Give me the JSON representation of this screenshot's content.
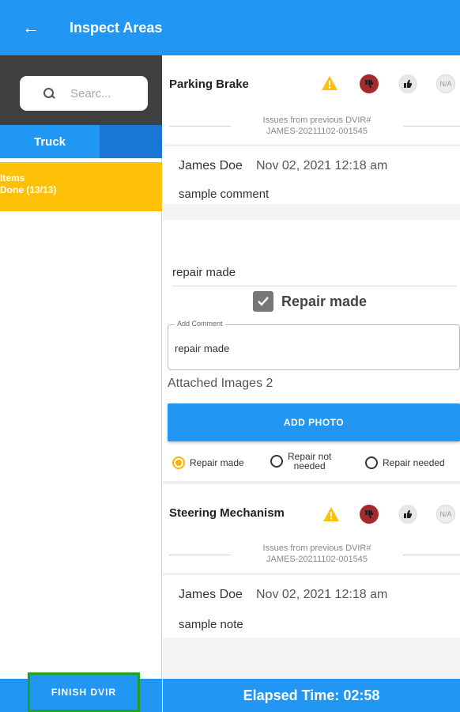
{
  "header": {
    "title": "Inspect Areas"
  },
  "sidebar": {
    "search_placeholder": "Searc...",
    "tab_truck": "Truck",
    "items_line1": "Items",
    "items_line2": "Done (13/13)",
    "finish_label": "FINISH DVIR"
  },
  "items": [
    {
      "title": "Parking Brake",
      "prev_issue_line1": "Issues from previous DVIR#",
      "prev_issue_line2": "JAMES-20211102-001545",
      "comment_name": "James Doe",
      "comment_date": "Nov 02, 2021 12:18 am",
      "comment_text": "sample comment"
    },
    {
      "title": "Steering Mechanism",
      "prev_issue_line1": "Issues from previous DVIR#",
      "prev_issue_line2": "JAMES-20211102-001545",
      "comment_name": "James Doe",
      "comment_date": "Nov 02, 2021 12:18 am",
      "comment_text": "sample note"
    }
  ],
  "status_buttons": {
    "na_label": "N/A"
  },
  "repair": {
    "repair_text": "repair made",
    "checkbox_label": "Repair made",
    "add_comment_legend": "Add Comment",
    "add_comment_value": "repair made",
    "attached_images": "Attached Images 2",
    "add_photo_label": "ADD PHOTO",
    "radio_repair_made": "Repair made",
    "radio_not_needed_line1": "Repair not",
    "radio_not_needed_line2": "needed",
    "radio_repair_needed": "Repair needed",
    "selected": "Repair made"
  },
  "footer": {
    "elapsed_label": "Elapsed Time:",
    "elapsed_value": "02:58"
  },
  "colors": {
    "primary": "#2196f3",
    "items_done": "#ffc107",
    "thumbs_down": "#a52a2a",
    "warning": "#ffc107",
    "finish_border": "#1fa31f"
  }
}
